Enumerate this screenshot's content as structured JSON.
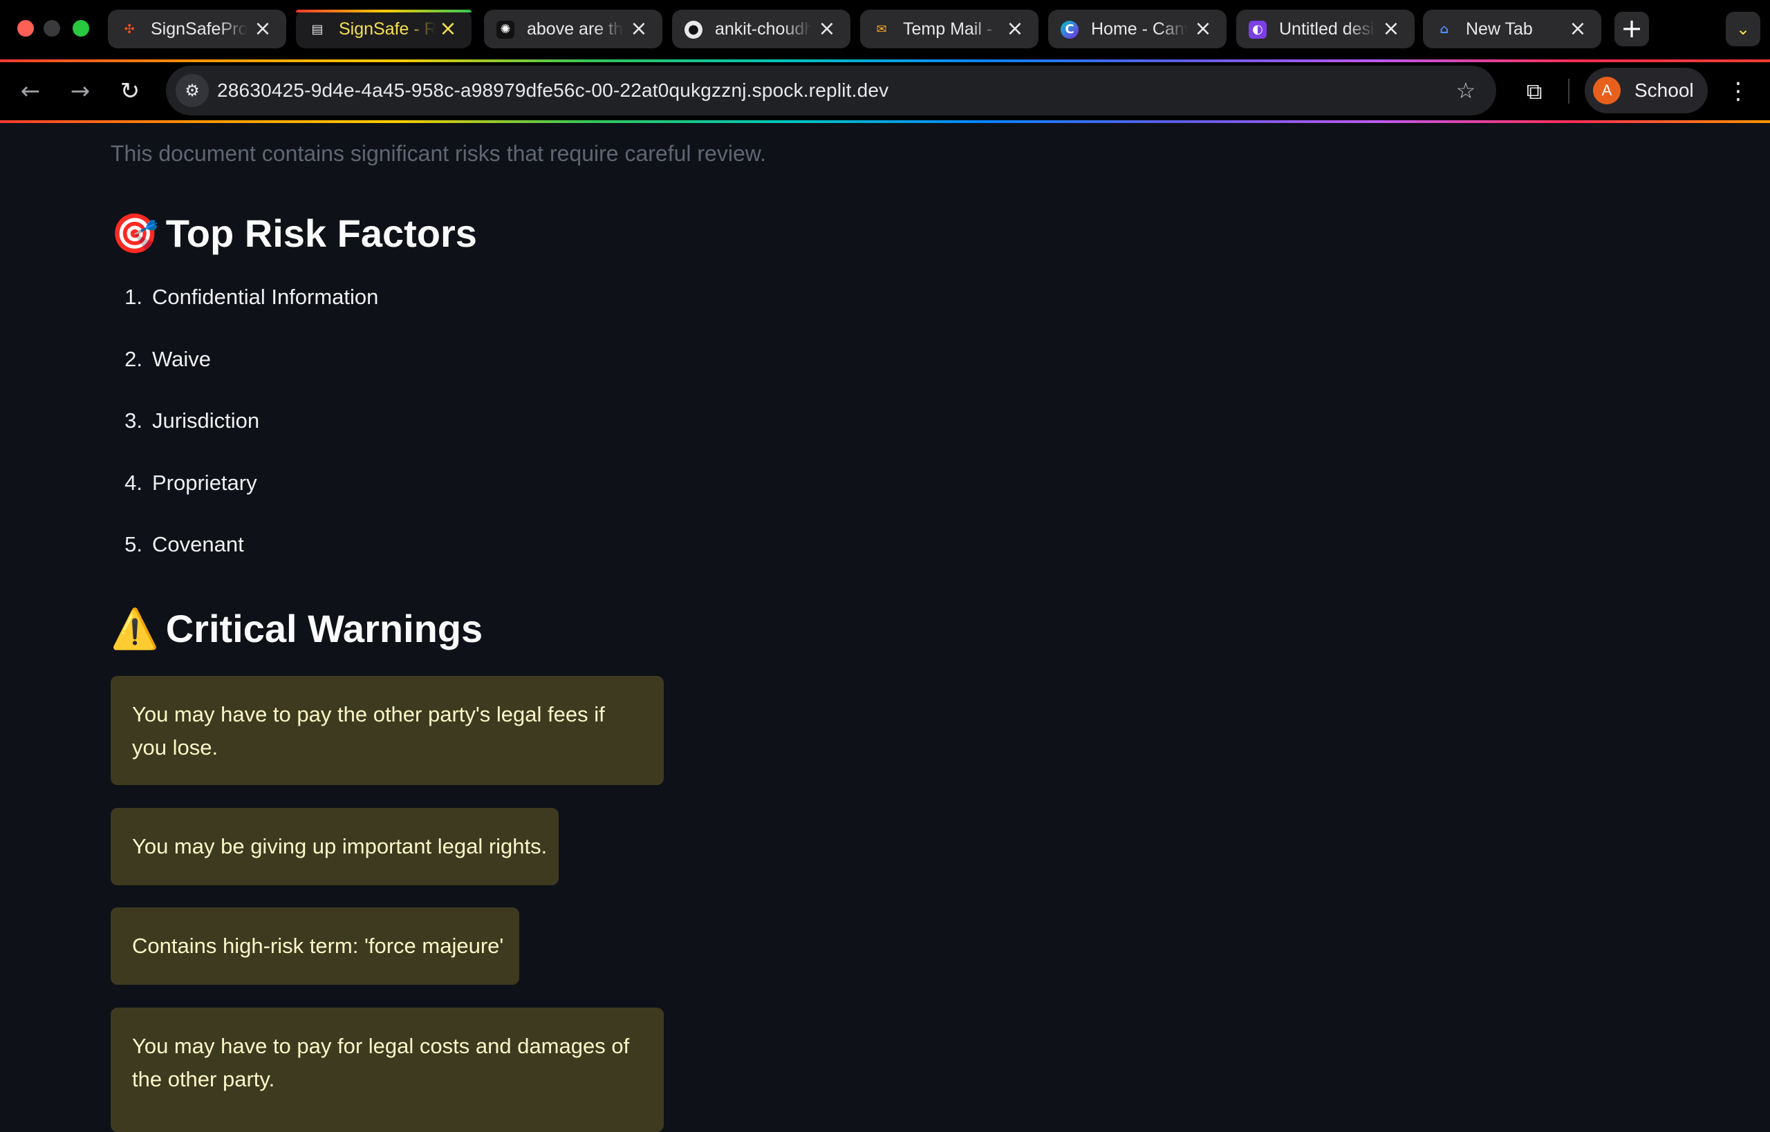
{
  "browser": {
    "tabs": [
      {
        "title": "SignSafePro",
        "favicon": "figma-icon",
        "active": false
      },
      {
        "title": "SignSafe - Replit",
        "favicon": "document-icon",
        "active": true
      },
      {
        "title": "above are the",
        "favicon": "openai-icon",
        "active": false
      },
      {
        "title": "ankit-choudhary",
        "favicon": "github-icon",
        "active": false
      },
      {
        "title": "Temp Mail - ",
        "favicon": "envelope-icon",
        "active": false
      },
      {
        "title": "Home - Canva",
        "favicon": "canva-icon",
        "active": false
      },
      {
        "title": "Untitled design",
        "favicon": "design-app-icon",
        "active": false
      },
      {
        "title": "New Tab",
        "favicon": "home-icon",
        "active": false
      }
    ],
    "url": "28630425-9d4e-4a45-958c-a98979dfe56c-00-22at0qukgzznj.spock.replit.dev",
    "profile": {
      "initial": "A",
      "name": "School"
    },
    "colors": {
      "active_tab_text": "#f4e04d",
      "avatar": "#e8601c"
    }
  },
  "page": {
    "summary": "This document contains significant risks that require careful review.",
    "risk_heading": {
      "emoji": "🎯",
      "text": "Top Risk Factors"
    },
    "risk_factors": [
      {
        "num": "1.",
        "label": "Confidential Information"
      },
      {
        "num": "2.",
        "label": "Waive"
      },
      {
        "num": "3.",
        "label": "Jurisdiction"
      },
      {
        "num": "4.",
        "label": "Proprietary"
      },
      {
        "num": "5.",
        "label": "Covenant"
      }
    ],
    "warnings_heading": {
      "emoji": "⚠️",
      "text": "Critical Warnings"
    },
    "warnings": [
      "You may have to pay the other party's legal fees if you lose.",
      "You may be giving up important legal rights.",
      "Contains high-risk term: 'force majeure'",
      "You may have to pay for legal costs and damages of the other party."
    ],
    "colors": {
      "background": "#0e1117",
      "warning_box": "#3e3a20",
      "warning_text": "#fcf6c8"
    }
  }
}
